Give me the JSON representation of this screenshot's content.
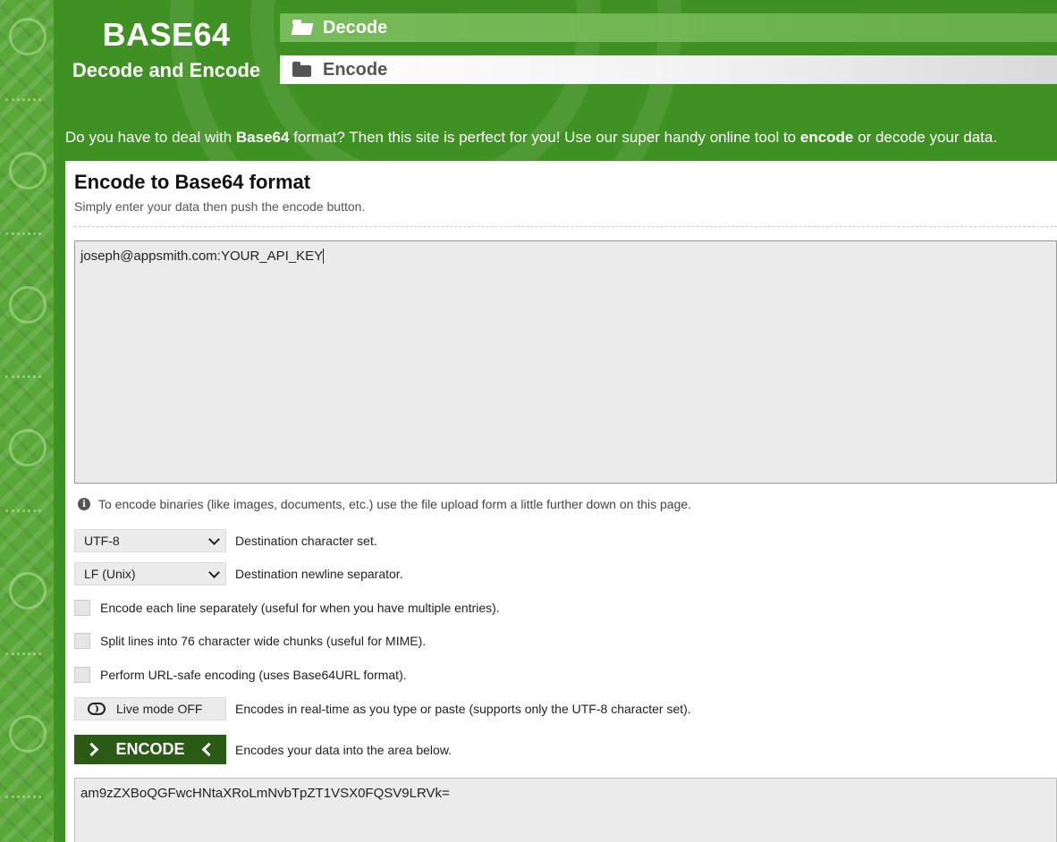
{
  "header": {
    "logo_title": "BASE64",
    "logo_subtitle": "Decode and Encode",
    "tabs": [
      {
        "label": "Decode",
        "icon": "folder-open-icon",
        "active": false
      },
      {
        "label": "Encode",
        "icon": "folder-icon",
        "active": true
      }
    ],
    "intro": {
      "part1": "Do you have to deal with ",
      "bold1": "Base64",
      "part2": " format? Then this site is perfect for you! Use our super handy online tool to ",
      "bold2": "encode",
      "part3": " or decode your data."
    }
  },
  "panel": {
    "title": "Encode to Base64 format",
    "subtitle": "Simply enter your data then push the encode button.",
    "input_value": "joseph@appsmith.com:YOUR_API_KEY",
    "info_text": "To encode binaries (like images, documents, etc.) use the file upload form a little further down on this page.",
    "charset": {
      "selected": "UTF-8",
      "label": "Destination character set."
    },
    "newline": {
      "selected": "LF (Unix)",
      "label": "Destination newline separator."
    },
    "options": [
      {
        "label": "Encode each line separately (useful for when you have multiple entries).",
        "checked": false
      },
      {
        "label": "Split lines into 76 character wide chunks (useful for MIME).",
        "checked": false
      },
      {
        "label": "Perform URL-safe encoding (uses Base64URL format).",
        "checked": false
      }
    ],
    "live_mode": {
      "label": "Live mode OFF",
      "description": "Encodes in real-time as you type or paste (supports only the UTF-8 character set)."
    },
    "encode_button": {
      "label": "ENCODE",
      "description": "Encodes your data into the area below."
    },
    "output_value": "am9zZXBoQGFwcHNtaXRoLmNvbTpZT1VSX0FQSV9LRVk="
  },
  "colors": {
    "header_green": "#3f9123",
    "button_dark_green": "#2b5a16"
  }
}
